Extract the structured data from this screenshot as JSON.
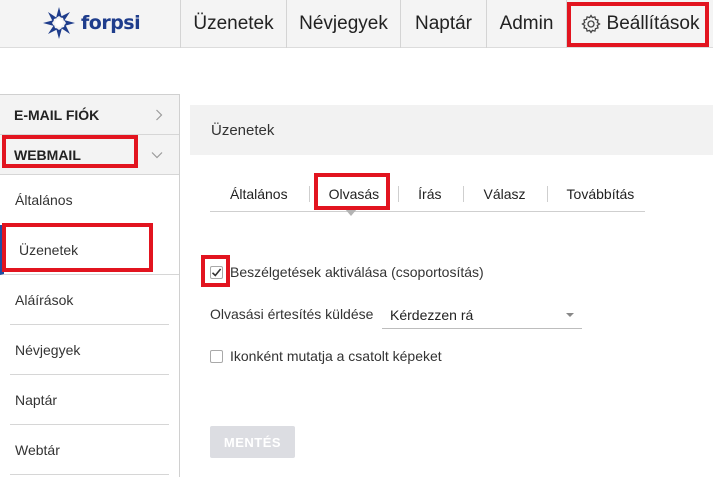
{
  "brand": {
    "logo_text": "forpsi",
    "logo_color": "#1f3d8c"
  },
  "nav": {
    "items": [
      {
        "label": "Üzenetek"
      },
      {
        "label": "Névjegyek"
      },
      {
        "label": "Naptár"
      },
      {
        "label": "Admin"
      },
      {
        "label": "Beállítások",
        "icon": "gear-icon"
      }
    ]
  },
  "sidebar": {
    "sections": [
      {
        "label": "E-MAIL FIÓK",
        "icon": "chevron-right-icon"
      },
      {
        "label": "WEBMAIL",
        "icon": "chevron-down-icon"
      }
    ],
    "items": [
      {
        "label": "Általános"
      },
      {
        "label": "Üzenetek",
        "active": true
      },
      {
        "label": "Aláírások"
      },
      {
        "label": "Névjegyek"
      },
      {
        "label": "Naptár"
      },
      {
        "label": "Webtár"
      }
    ]
  },
  "main": {
    "title": "Üzenetek",
    "tabs": [
      {
        "label": "Általános"
      },
      {
        "label": "Olvasás",
        "active": true
      },
      {
        "label": "Írás"
      },
      {
        "label": "Válasz"
      },
      {
        "label": "Továbbítás"
      }
    ],
    "options": {
      "conversations_label": "Beszélgetések aktiválása (csoportosítás)",
      "conversations_checked": true,
      "read_receipt_label": "Olvasási értesítés küldése",
      "read_receipt_value": "Kérdezzen rá",
      "inline_images_label": "Ikonként mutatja a csatolt képeket",
      "inline_images_checked": false
    },
    "save_label": "MENTÉS"
  },
  "colors": {
    "highlight": "#e2141f",
    "active_bar": "#1f4ea3",
    "button_disabled": "#dcdde2"
  }
}
